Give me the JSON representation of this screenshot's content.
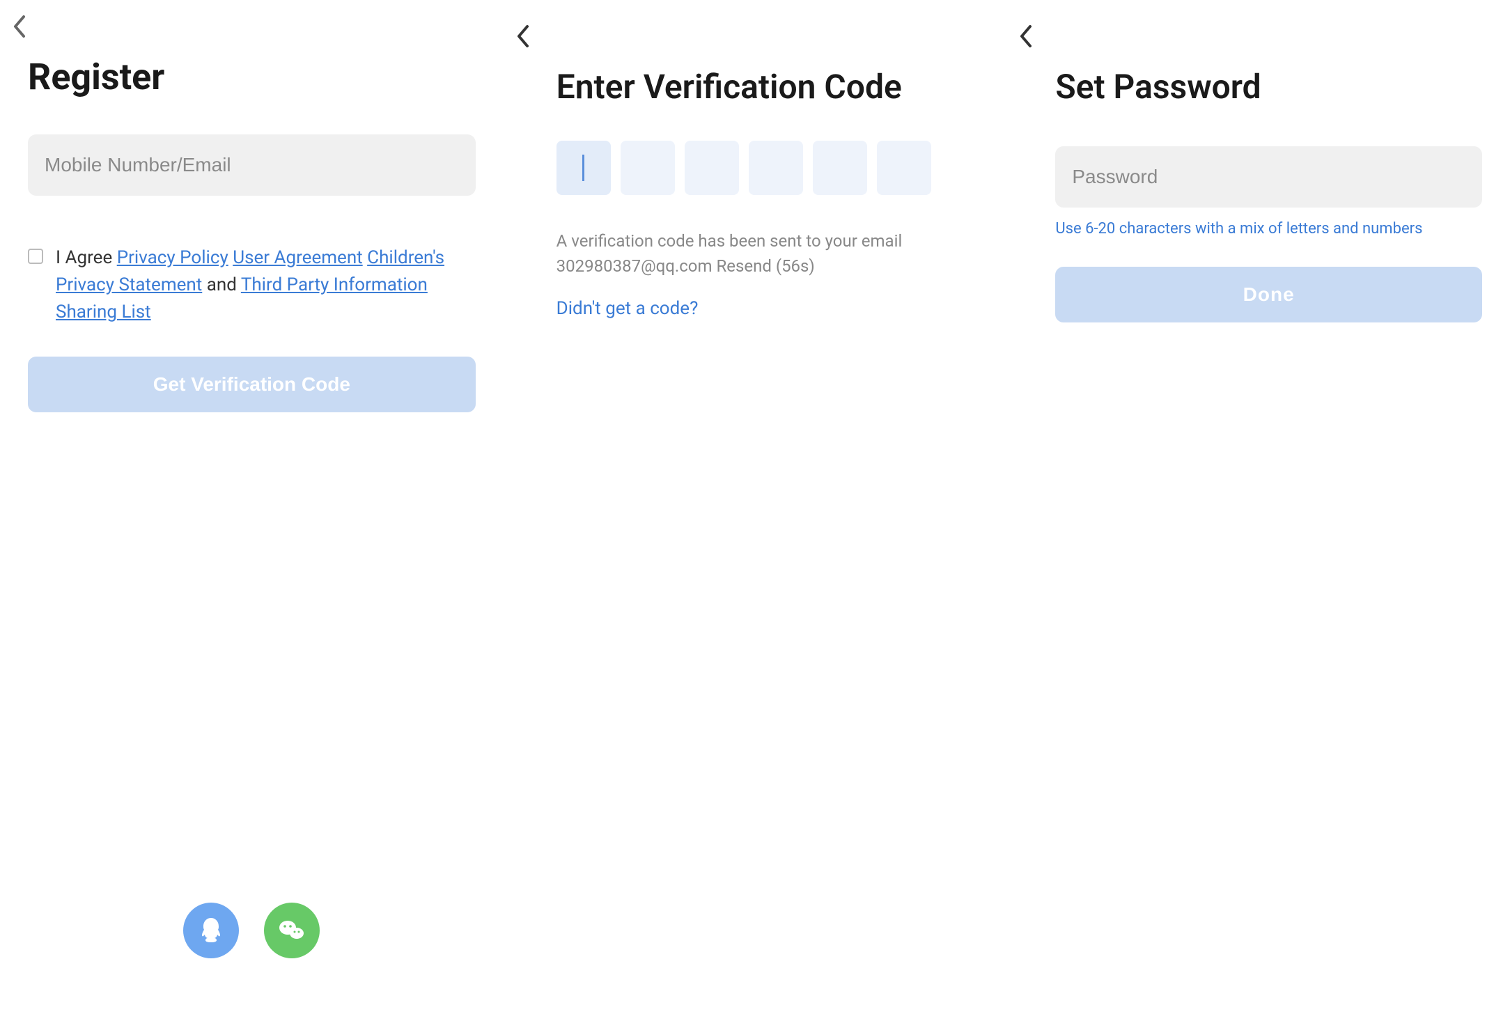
{
  "screen1": {
    "title": "Register",
    "input_placeholder": "Mobile Number/Email",
    "agree_prefix": "I Agree ",
    "link_privacy": "Privacy Policy",
    "link_user_agreement": "User Agreement",
    "link_children_privacy": "Children's Privacy Statement",
    "agree_and": " and ",
    "link_third_party": "Third Party Information Sharing List",
    "button_label": "Get Verification Code",
    "social_qq": "qq",
    "social_wechat": "wechat"
  },
  "screen2": {
    "title": "Enter Verification Code",
    "sent_line1": "A verification code has been sent to your email",
    "sent_line2": "302980387@qq.com Resend (56s)",
    "no_code_link": "Didn't get a code?"
  },
  "screen3": {
    "title": "Set Password",
    "input_placeholder": "Password",
    "hint": "Use 6-20 characters with a mix of letters and numbers",
    "button_label": "Done"
  }
}
